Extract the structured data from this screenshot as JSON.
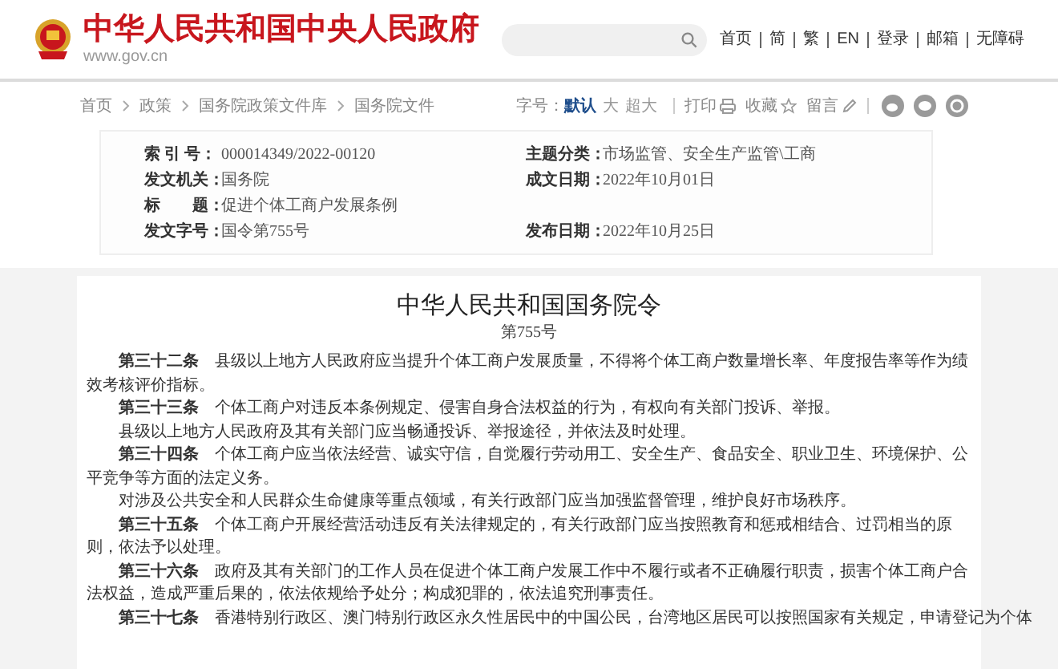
{
  "header": {
    "site_title": "中华人民共和国中央人民政府",
    "site_url": "www.gov.cn",
    "nav": [
      "首页",
      "简",
      "繁",
      "EN",
      "登录",
      "邮箱",
      "无障碍"
    ]
  },
  "breadcrumb": [
    "首页",
    "政策",
    "国务院政策文件库",
    "国务院文件"
  ],
  "toolbar": {
    "font_size_label": "字号：",
    "font_sizes": [
      {
        "label": "默认",
        "selected": true
      },
      {
        "label": "大",
        "selected": false
      },
      {
        "label": "超大",
        "selected": false
      }
    ],
    "actions": [
      {
        "label": "打印",
        "kind": "print"
      },
      {
        "label": "收藏",
        "kind": "star"
      },
      {
        "label": "留言",
        "kind": "pencil"
      }
    ],
    "share": [
      {
        "kind": "weibo"
      },
      {
        "kind": "wechat"
      },
      {
        "kind": "other"
      }
    ]
  },
  "meta": [
    {
      "label": "索 引 号：",
      "value": "000014349/2022-00120",
      "label2": "主题分类：",
      "value2": "市场监管、安全生产监管\\工商"
    },
    {
      "label": "发文机关：",
      "value": "国务院",
      "label2": "成文日期：",
      "value2": "2022年10月01日"
    },
    {
      "label": "标　　题：",
      "value": "促进个体工商户发展条例"
    },
    {
      "label": "发文字号：",
      "value": "国令第755号",
      "label2": "发布日期：",
      "value2": "2022年10月25日"
    }
  ],
  "document": {
    "title": "中华人民共和国国务院令",
    "number": "第755号",
    "paragraphs": [
      {
        "article": "第三十二条",
        "text": "县级以上地方人民政府应当提升个体工商户发展质量，不得将个体工商户数量增长率、年度报告率等作为绩效考核评价指标。"
      },
      {
        "article": "第三十三条",
        "text": "个体工商户对违反本条例规定、侵害自身合法权益的行为，有权向有关部门投诉、举报。"
      },
      {
        "text": "县级以上地方人民政府及其有关部门应当畅通投诉、举报途径，并依法及时处理。"
      },
      {
        "article": "第三十四条",
        "text": "个体工商户应当依法经营、诚实守信，自觉履行劳动用工、安全生产、食品安全、职业卫生、环境保护、公平竞争等方面的法定义务。"
      },
      {
        "text": "对涉及公共安全和人民群众生命健康等重点领域，有关行政部门应当加强监督管理，维护良好市场秩序。"
      },
      {
        "article": "第三十五条",
        "text": "个体工商户开展经营活动违反有关法律规定的，有关行政部门应当按照教育和惩戒相结合、过罚相当的原则，依法予以处理。"
      },
      {
        "article": "第三十六条",
        "text": "政府及其有关部门的工作人员在促进个体工商户发展工作中不履行或者不正确履行职责，损害个体工商户合法权益，造成严重后果的，依法依规给予处分；构成犯罪的，依法追究刑事责任。"
      },
      {
        "article": "第三十七条",
        "text": "香港特别行政区、澳门特别行政区永久性居民中的中国公民，台湾地区居民可以按照国家有关规定，申请登记为个体"
      }
    ]
  }
}
